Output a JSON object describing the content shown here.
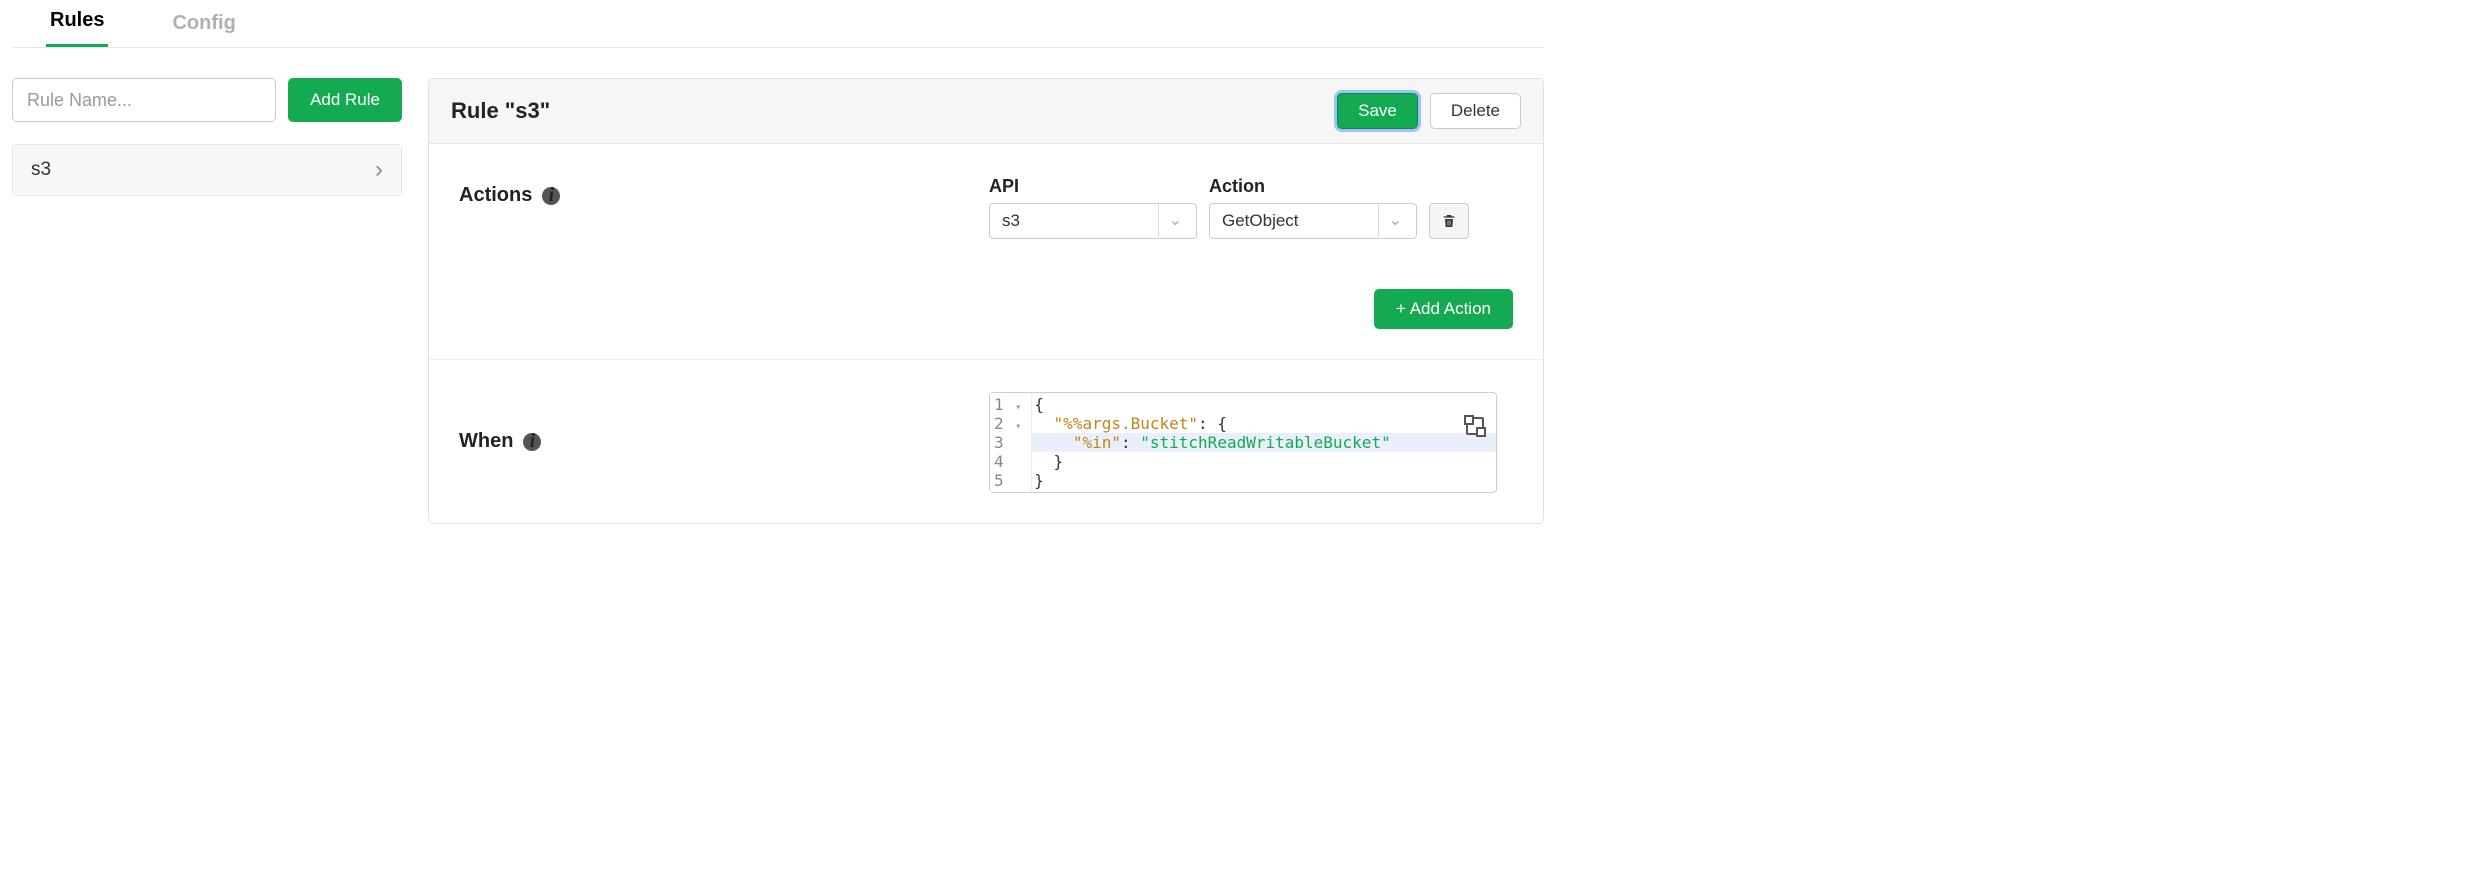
{
  "tabs": {
    "rules": "Rules",
    "config": "Config"
  },
  "sidebar": {
    "rule_name_placeholder": "Rule Name...",
    "add_rule_label": "Add Rule",
    "rules": [
      {
        "label": "s3"
      }
    ]
  },
  "panel": {
    "title": "Rule \"s3\"",
    "save_label": "Save",
    "delete_label": "Delete"
  },
  "actions": {
    "heading": "Actions",
    "api_label": "API",
    "api_selected": "s3",
    "action_label": "Action",
    "action_selected": "GetObject",
    "add_action_label": "+ Add Action"
  },
  "when": {
    "heading": "When",
    "code": {
      "lines": [
        "1",
        "2",
        "3",
        "4",
        "5"
      ],
      "l1_open": "{",
      "l2_key": "\"%%args.Bucket\"",
      "l2_colon_open": ": {",
      "l3_key": "\"%in\"",
      "l3_colon": ": ",
      "l3_val": "\"stitchReadWritableBucket\"",
      "l4_close": "}",
      "l5_close": "}"
    }
  }
}
